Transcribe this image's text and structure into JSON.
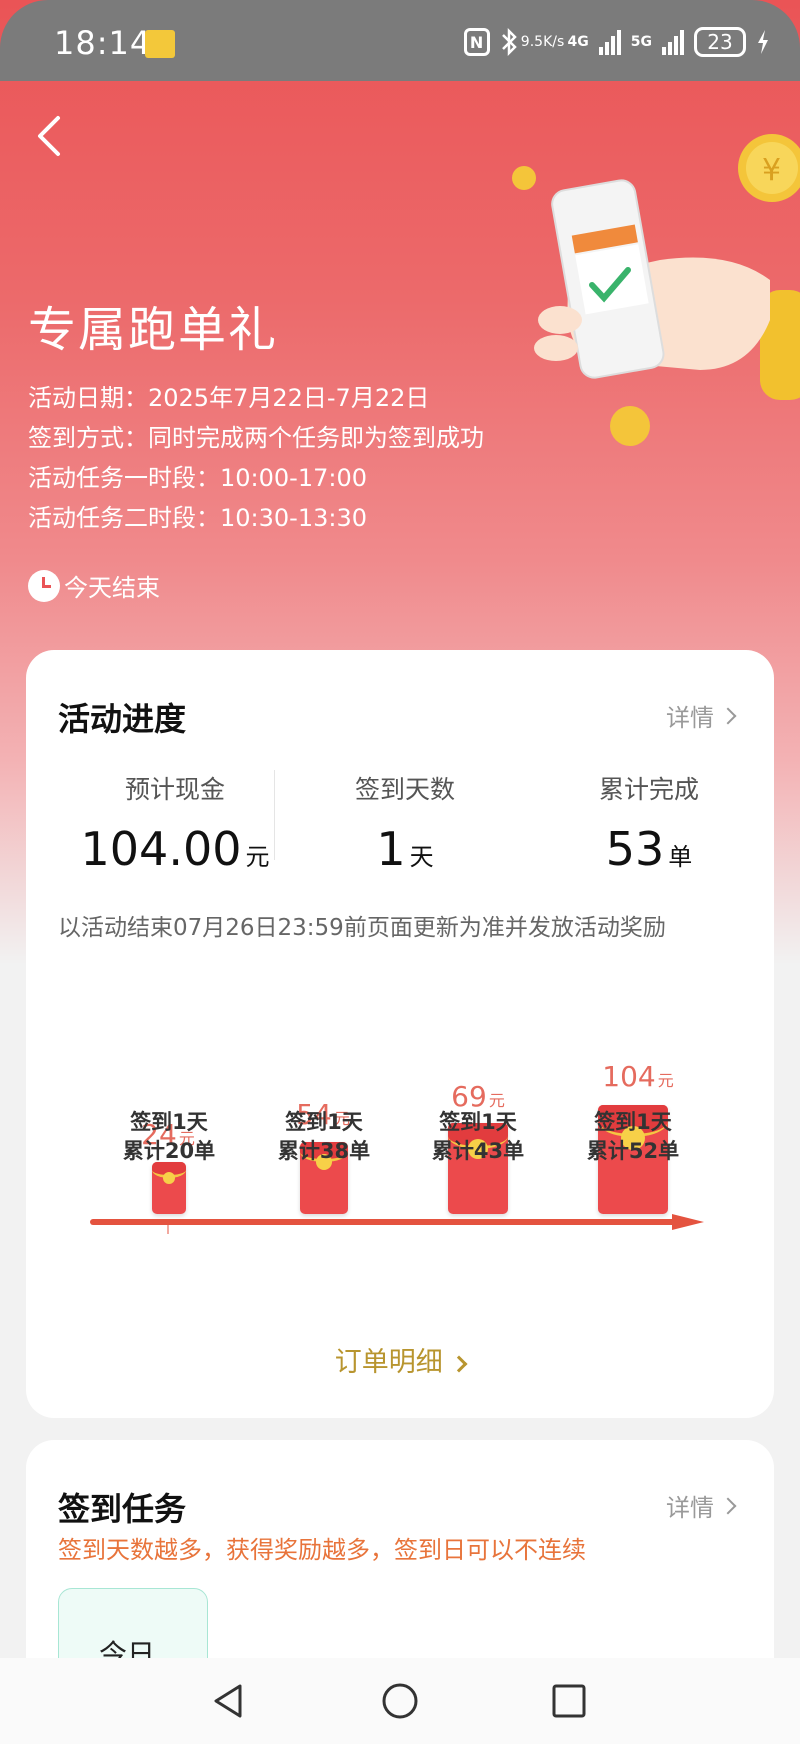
{
  "status_bar": {
    "time": "18:14",
    "net_speed_value": "9.5",
    "net_speed_unit": "K/s",
    "network_1": "4G",
    "network_2": "5G",
    "battery": "23"
  },
  "header": {
    "title": "专属跑单礼",
    "info_lines": [
      "活动日期：2025年7月22日-7月22日",
      "签到方式：同时完成两个任务即为签到成功",
      "活动任务一时段：10:00-17:00",
      "活动任务二时段：10:30-13:30"
    ],
    "deadline": "今天结束"
  },
  "progress_card": {
    "title": "活动进度",
    "detail_link": "详情",
    "stats": [
      {
        "label": "预计现金",
        "value": "104.00",
        "unit": "元"
      },
      {
        "label": "签到天数",
        "value": "1",
        "unit": "天"
      },
      {
        "label": "累计完成",
        "value": "53",
        "unit": "单"
      }
    ],
    "note": "以活动结束07月26日23:59前页面更新为准并发放活动奖励",
    "tiers": [
      {
        "amount": "24",
        "unit": "元",
        "line1": "签到1天",
        "line2": "累计20单"
      },
      {
        "amount": "54",
        "unit": "元",
        "line1": "签到1天",
        "line2": "累计38单"
      },
      {
        "amount": "69",
        "unit": "元",
        "line1": "签到1天",
        "line2": "累计43单"
      },
      {
        "amount": "104",
        "unit": "元",
        "line1": "签到1天",
        "line2": "累计52单"
      }
    ],
    "orders_link": "订单明细"
  },
  "checkin_card": {
    "title": "签到任务",
    "detail_link": "详情",
    "tip": "签到天数越多，获得奖励越多，签到日可以不连续",
    "day_tile": "今日"
  },
  "colors": {
    "brand_red": "#ea5456",
    "gold_link": "#b8952f",
    "orange_tip": "#e8743b"
  }
}
